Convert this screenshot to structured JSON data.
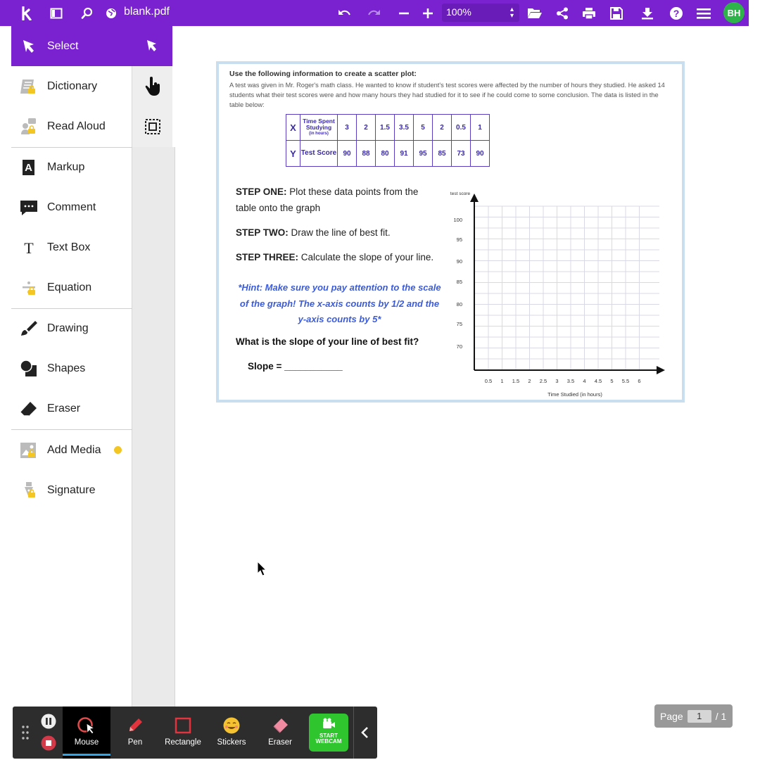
{
  "app": {
    "file_name": "blank.pdf",
    "zoom": "100%",
    "user_initials": "BH"
  },
  "sidebar": {
    "items": [
      {
        "label": "Select",
        "icon": "pointer-icon",
        "locked": false
      },
      {
        "label": "Dictionary",
        "icon": "book-icon",
        "locked": true
      },
      {
        "label": "Read Aloud",
        "icon": "speaker-person-icon",
        "locked": true
      },
      {
        "label": "Markup",
        "icon": "highlighter-icon",
        "locked": false
      },
      {
        "label": "Comment",
        "icon": "comment-icon",
        "locked": false
      },
      {
        "label": "Text Box",
        "icon": "text-icon",
        "locked": false
      },
      {
        "label": "Equation",
        "icon": "divide-icon",
        "locked": true
      },
      {
        "label": "Drawing",
        "icon": "brush-icon",
        "locked": false
      },
      {
        "label": "Shapes",
        "icon": "shapes-icon",
        "locked": false
      },
      {
        "label": "Eraser",
        "icon": "eraser-icon",
        "locked": false
      },
      {
        "label": "Add Media",
        "icon": "image-icon",
        "locked": true
      },
      {
        "label": "Signature",
        "icon": "pen-nib-icon",
        "locked": true
      }
    ]
  },
  "document": {
    "heading": "Use the following information to create a scatter plot:",
    "paragraph": "A test was given in Mr. Roger's math class. He wanted to know if student's test scores were affected by the number of hours they studied. He asked 14 students what their test scores were and how many hours they had studied for it to see if he could come to some conclusion. The data is listed in the table below:",
    "table": {
      "x_label": "X",
      "x_header": "Time Spent Studying",
      "x_header_sub": "(in hours)",
      "y_label": "Y",
      "y_header": "Test Score",
      "x_values": [
        "3",
        "2",
        "1.5",
        "3.5",
        "5",
        "2",
        "0.5",
        "1"
      ],
      "y_values": [
        "90",
        "88",
        "80",
        "91",
        "95",
        "85",
        "73",
        "90"
      ]
    },
    "step_one_bold": "STEP ONE:",
    "step_one_text": " Plot these data points from the table onto the graph",
    "step_two_bold": "STEP TWO:",
    "step_two_text": " Draw the line of best fit.",
    "step_three_bold": "STEP THREE:",
    "step_three_text": " Calculate the slope of your line.",
    "hint": "*Hint: Make sure you pay attention to the scale of the graph! The x-axis counts by 1/2 and the y-axis counts by 5*",
    "question": "What is the slope of your line of best fit?",
    "slope_label": "Slope = ___________",
    "graph": {
      "y_axis_label": "test score",
      "x_axis_label": "Time Studied (in hours)",
      "y_ticks": [
        "100",
        "95",
        "90",
        "85",
        "80",
        "75",
        "70"
      ],
      "x_ticks": [
        "0.5",
        "1",
        "1.5",
        "2",
        "2.5",
        "3",
        "3.5",
        "4",
        "4.5",
        "5",
        "5.5",
        "6"
      ]
    }
  },
  "pager": {
    "label": "Page",
    "current": "1",
    "total": "/ 1"
  },
  "recorder": {
    "tools": [
      {
        "label": "Mouse",
        "icon": "mouse-cursor-icon"
      },
      {
        "label": "Pen",
        "icon": "pen-icon"
      },
      {
        "label": "Rectangle",
        "icon": "rectangle-icon"
      },
      {
        "label": "Stickers",
        "icon": "smiley-icon"
      },
      {
        "label": "Eraser",
        "icon": "eraser-icon"
      }
    ],
    "webcam_line1": "START",
    "webcam_line2": "WEBCAM"
  },
  "colors": {
    "brand": "#7a22cf",
    "avatar": "#2db34a",
    "webcam": "#2ec52e",
    "table_border": "#5a3dc0",
    "hint": "#3b5bd8"
  }
}
